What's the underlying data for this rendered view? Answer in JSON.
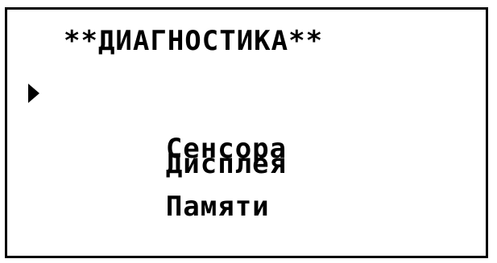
{
  "screen": {
    "title": "**ДИАГНОСТИКА**",
    "selected_index": 0,
    "cursor_icon": "selection-arrow-icon",
    "items": [
      {
        "label": "Сенсора"
      },
      {
        "label": "Дисплея"
      },
      {
        "label": "Памяти"
      }
    ]
  }
}
